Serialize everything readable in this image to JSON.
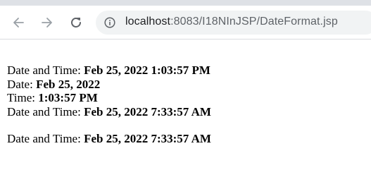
{
  "browser": {
    "url_host": "localhost",
    "url_rest": ":8083/I18NInJSP/DateFormat.jsp"
  },
  "content": {
    "lines": [
      {
        "label": "Date and Time: ",
        "value": "Feb 25, 2022 1:03:57 PM"
      },
      {
        "label": "Date: ",
        "value": "Feb 25, 2022"
      },
      {
        "label": "Time: ",
        "value": "1:03:57 PM"
      },
      {
        "label": "Date and Time: ",
        "value": "Feb 25, 2022 7:33:57 AM"
      }
    ],
    "final_line": {
      "label": "Date and Time: ",
      "value": "Feb 25, 2022 7:33:57 AM"
    }
  },
  "colors": {
    "toolbar_bg": "#ffffff",
    "omnibox_bg": "#f1f3f4",
    "icon": "#5f6368"
  },
  "icons": {
    "back": "arrow-left-icon",
    "forward": "arrow-right-icon",
    "reload": "reload-icon",
    "site_info": "info-icon"
  }
}
